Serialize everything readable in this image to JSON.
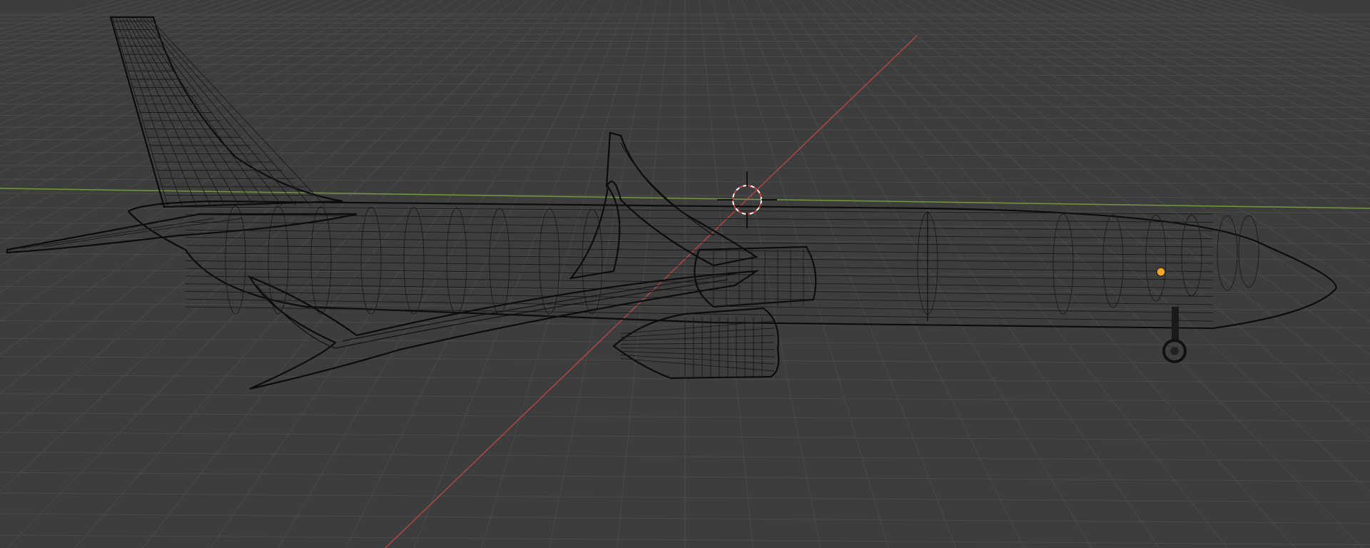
{
  "viewport": {
    "mode": "wireframe",
    "background": "#3d3d3d",
    "grid_color": "#4a4a4a",
    "x_axis_color": "#d04a4a",
    "y_axis_color": "#6f9a3c",
    "wire_color": "#111111",
    "origin_color": "#f5a623",
    "objects": [
      {
        "name": "aircraft-model",
        "icon": "mesh-icon"
      },
      {
        "name": "3d-cursor",
        "icon": "crosshair-icon"
      },
      {
        "name": "object-origin",
        "icon": "dot-icon"
      }
    ]
  }
}
